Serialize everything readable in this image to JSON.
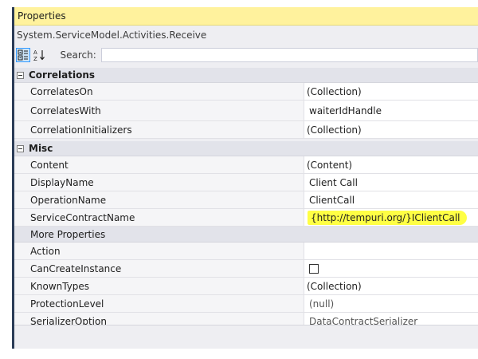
{
  "window": {
    "title": "Properties"
  },
  "object_name": "System.ServiceModel.Activities.Receive",
  "toolbar": {
    "search_label": "Search:",
    "search_value": "",
    "search_placeholder": ""
  },
  "categories": [
    {
      "name": "Correlations",
      "rows": [
        {
          "name": "CorrelatesOn",
          "value": "(Collection)"
        },
        {
          "name": "CorrelatesWith",
          "value": "waiterIdHandle"
        },
        {
          "name": "CorrelationInitializers",
          "value": "(Collection)"
        }
      ]
    },
    {
      "name": "Misc",
      "rows": [
        {
          "name": "Content",
          "value": "(Content)"
        },
        {
          "name": "DisplayName",
          "value": "Client Call"
        },
        {
          "name": "OperationName",
          "value": "ClientCall"
        },
        {
          "name": "ServiceContractName",
          "value": "{http://tempuri.org/}IClientCall"
        }
      ],
      "more_label": "More Properties",
      "more_rows": [
        {
          "name": "Action",
          "value": ""
        },
        {
          "name": "CanCreateInstance",
          "value": ""
        },
        {
          "name": "KnownTypes",
          "value": "(Collection)"
        },
        {
          "name": "ProtectionLevel",
          "value": "(null)"
        },
        {
          "name": "SerializerOption",
          "value": "DataContractSerializer"
        }
      ]
    }
  ],
  "colors": {
    "title_bg": "#fff29d",
    "highlight": "#ffff44",
    "accent": "#3399ff"
  }
}
